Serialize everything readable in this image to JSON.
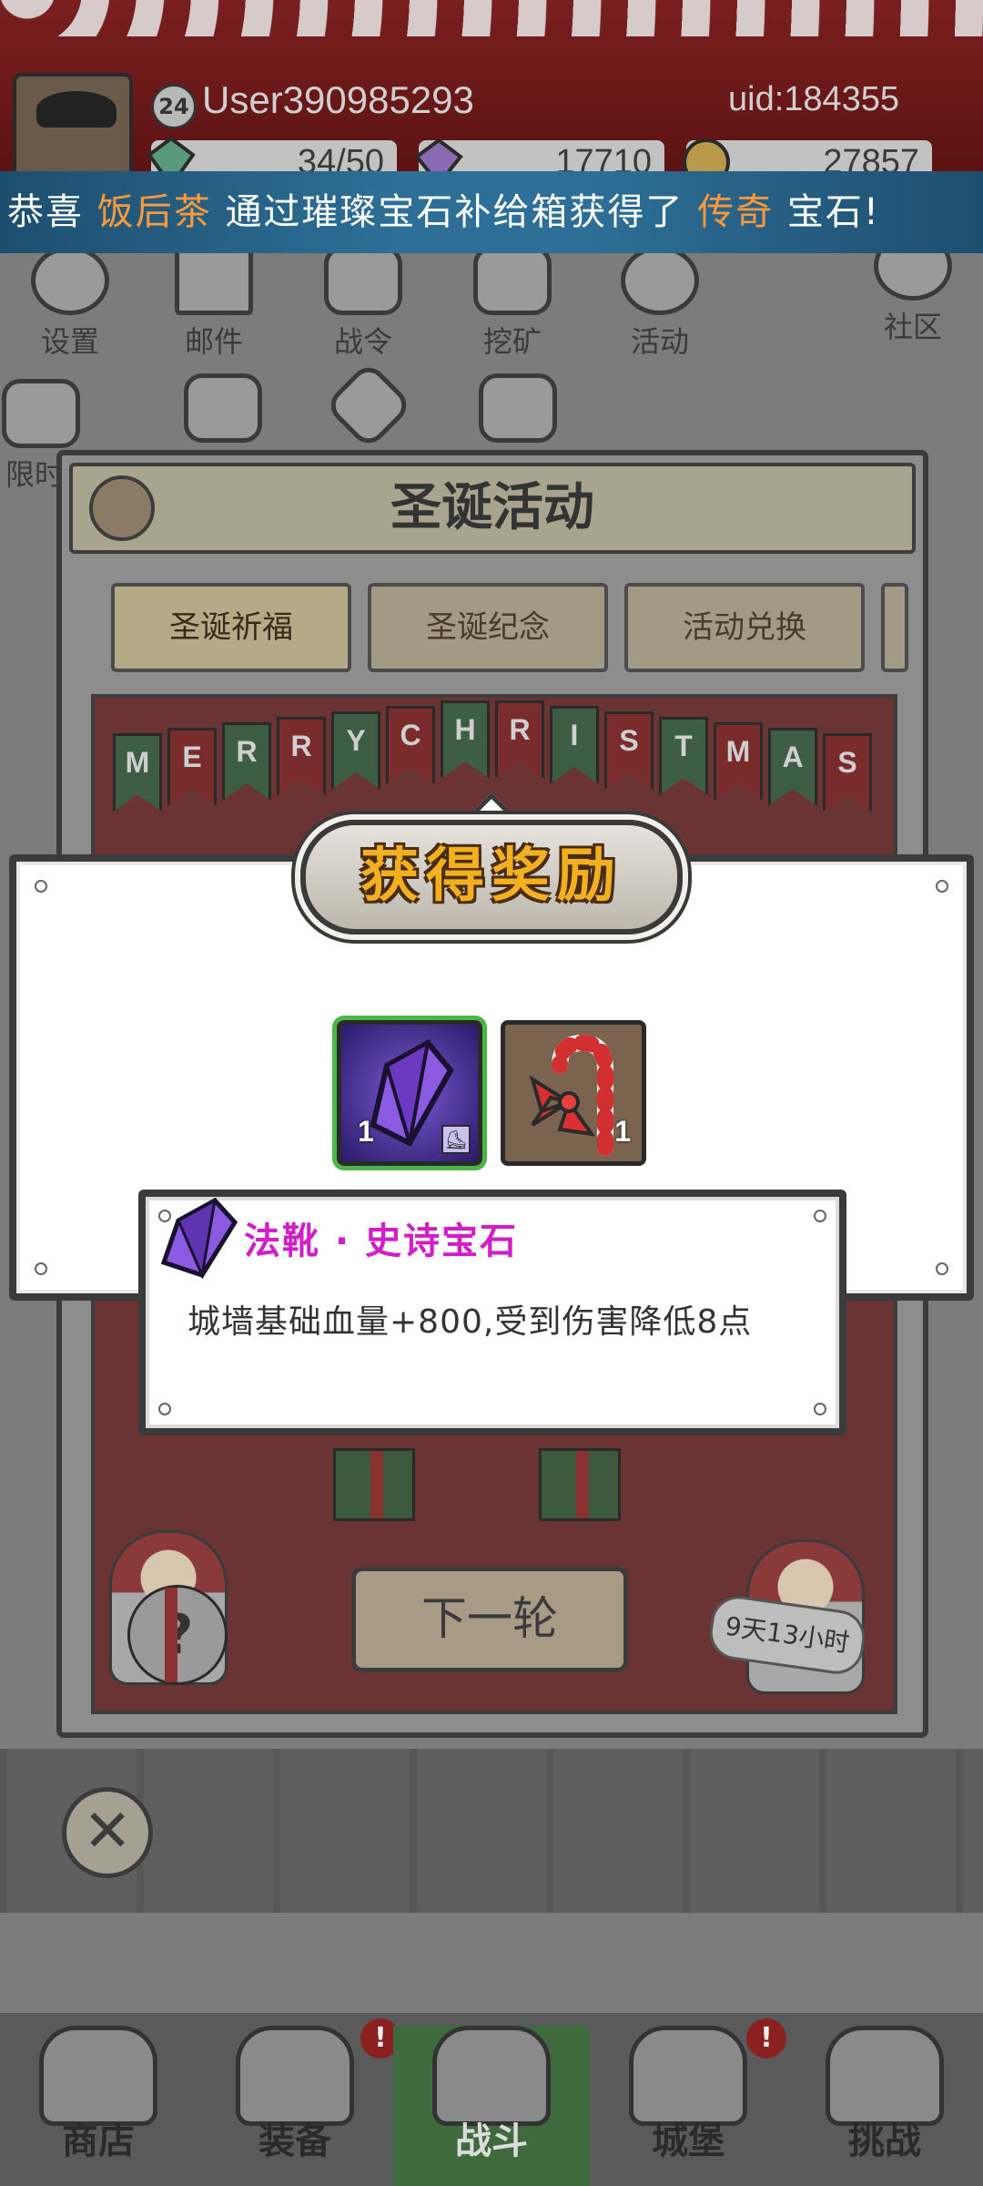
{
  "player": {
    "level": "24",
    "username": "User390985293",
    "uid": "uid:184355"
  },
  "resources": {
    "energy": "34/50",
    "gems": "17710",
    "coins": "27857"
  },
  "broadcast": {
    "prefix": "恭喜",
    "player_name": "饭后茶",
    "middle": "通过璀璨宝石补给箱获得了",
    "rarity": "传奇",
    "suffix": "宝石!"
  },
  "menu": {
    "row1": [
      "设置",
      "邮件",
      "战令",
      "挖矿",
      "活动",
      "社区"
    ],
    "limited": "限时"
  },
  "event": {
    "title": "圣诞活动",
    "tabs": [
      "圣诞祈福",
      "圣诞纪念",
      "活动兑换"
    ],
    "banner_letters": [
      "M",
      "E",
      "R",
      "R",
      "Y",
      "C",
      "H",
      "R",
      "I",
      "S",
      "T",
      "M",
      "A",
      "S"
    ],
    "next_round": "下一轮",
    "timer": "9天13小时"
  },
  "reward_modal": {
    "title": "获得奖励",
    "items": [
      {
        "icon": "purple-gem-icon",
        "count": "1"
      },
      {
        "icon": "candy-cane-icon",
        "count": "1"
      }
    ]
  },
  "tooltip": {
    "name": "法靴 · 史诗宝石",
    "description": "城墙基础血量+800,受到伤害降低8点"
  },
  "bottom_nav": {
    "items": [
      "商店",
      "装备",
      "战斗",
      "城堡",
      "挑战"
    ],
    "badge": "!"
  },
  "colors": {
    "epic_purple": "#d21ec8",
    "title_gold": "#f2b020",
    "broadcast_highlight": "#ff9a3c",
    "broadcast_bg": "#2d6f97",
    "active_slot_green": "#4cb548"
  }
}
